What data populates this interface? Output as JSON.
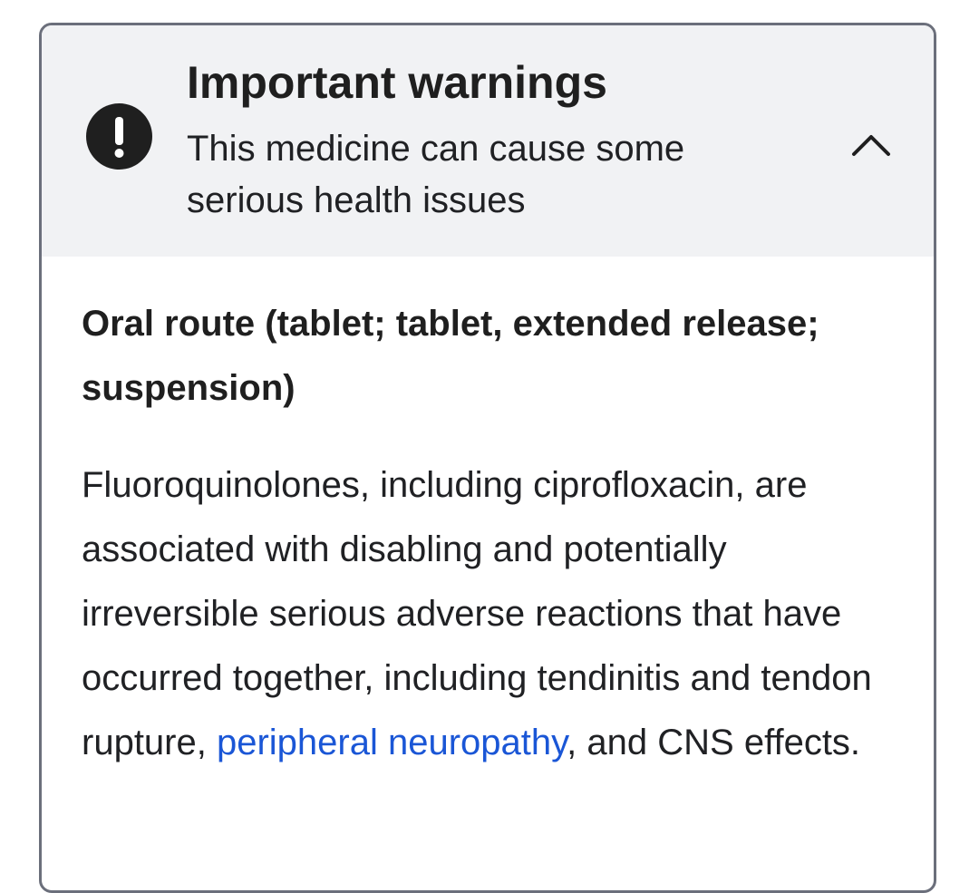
{
  "warning": {
    "title": "Important warnings",
    "subtitle": "This medicine can cause some serious health issues",
    "icon": "exclamation-circle-icon",
    "toggle_icon": "chevron-up-icon",
    "expanded": true
  },
  "content": {
    "route": "Oral route (tablet; tablet, extended release; suspension)",
    "paragraph_before_link": "Fluoroquinolones, including ciprofloxacin, are associated with disabling and potentially irreversible serious adverse reactions that have occurred together, including tendinitis and tendon rupture, ",
    "link_text": "peripheral neuropathy",
    "paragraph_after_link": ", and CNS effects."
  },
  "colors": {
    "header_bg": "#f1f2f4",
    "border": "#6b6f7b",
    "text": "#202124",
    "link": "#1a56d6",
    "icon_bg": "#1f1f1f"
  }
}
